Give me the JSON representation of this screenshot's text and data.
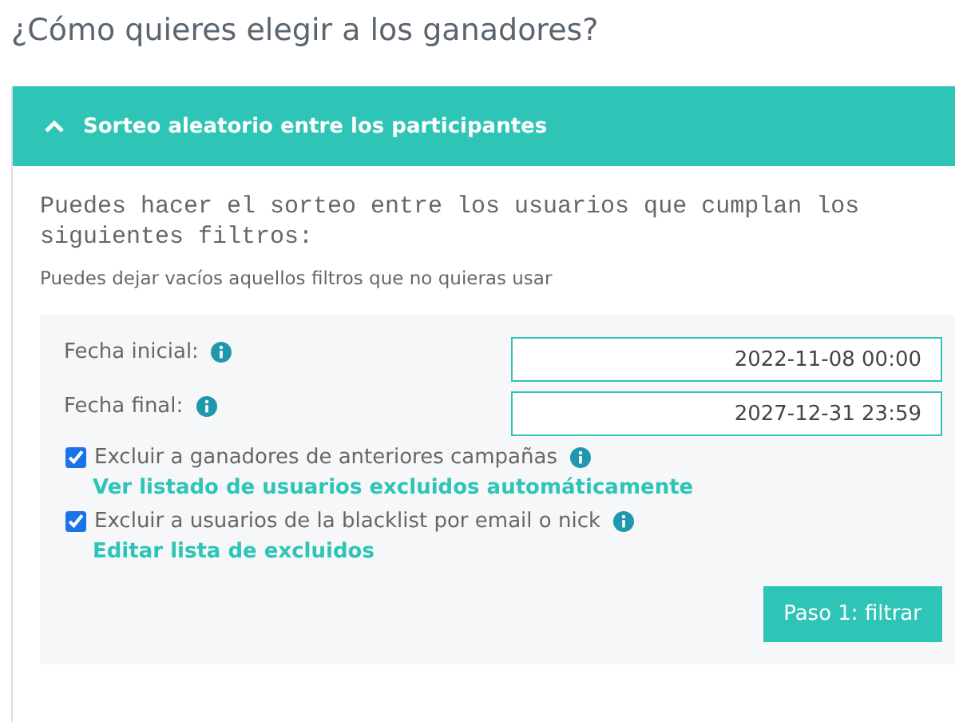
{
  "heading": "¿Cómo quieres elegir a los ganadores?",
  "section": {
    "title": "Sorteo aleatorio entre los participantes",
    "expanded": true,
    "intro": "Puedes hacer el sorteo entre los usuarios que cumplan los siguientes filtros:",
    "hint": "Puedes dejar vacíos aquellos filtros que no quieras usar",
    "fields": [
      {
        "label": "Fecha inicial:",
        "value": "2022-11-08 00:00"
      },
      {
        "label": "Fecha final:",
        "value": "2027-12-31 23:59"
      }
    ],
    "options": [
      {
        "label": "Excluir a ganadores de anteriores campañas",
        "checked": true,
        "link": "Ver listado de usuarios excluidos automáticamente"
      },
      {
        "label": "Excluir a usuarios de la blacklist por email o nick",
        "checked": true,
        "link": "Editar lista de excluidos"
      }
    ],
    "button": "Paso 1: filtrar"
  }
}
